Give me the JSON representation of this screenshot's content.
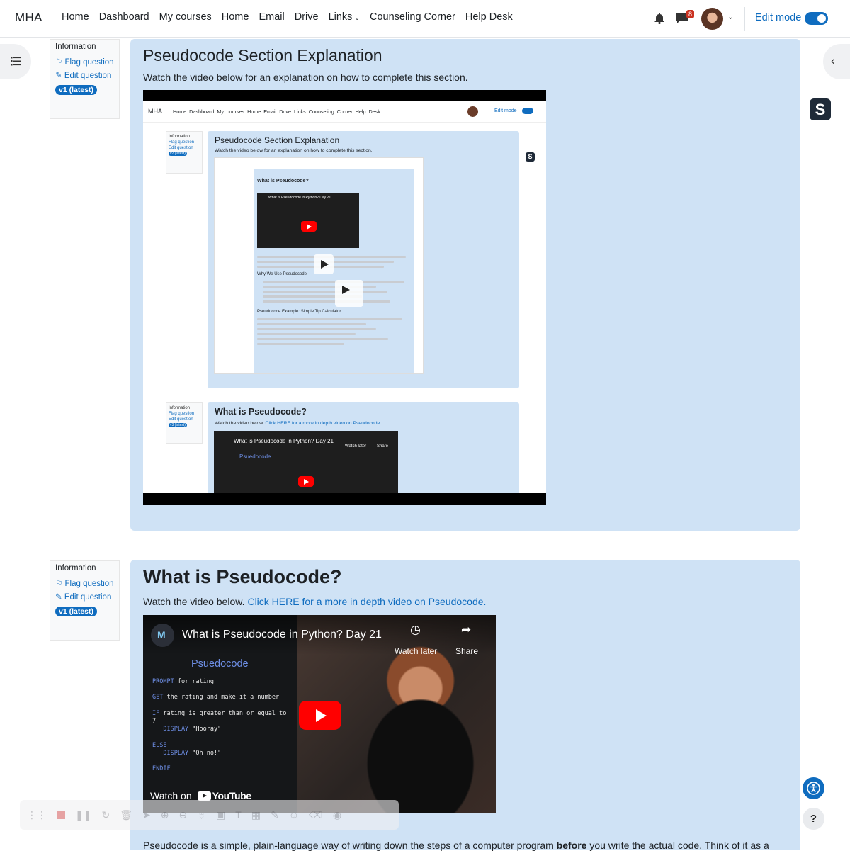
{
  "navbar": {
    "brand": "MHA",
    "links": [
      {
        "label": "Home"
      },
      {
        "label": "Dashboard"
      },
      {
        "label": "My courses"
      },
      {
        "label": "Home"
      },
      {
        "label": "Email"
      },
      {
        "label": "Drive"
      },
      {
        "label": "Links",
        "has_dropdown": true
      },
      {
        "label": "Counseling Corner"
      },
      {
        "label": "Help Desk"
      }
    ],
    "message_badge": "8",
    "edit_mode_label": "Edit mode",
    "edit_mode_on": true,
    "accent_color": "#0f6cbf"
  },
  "question1": {
    "info": {
      "title": "Information",
      "flag": "Flag question",
      "edit": "Edit question",
      "version": "v1 (latest)"
    },
    "title": "Pseudocode Section Explanation",
    "subtitle": "Watch the video below for an explanation on how to complete this section.",
    "recording": {
      "brand": "MHA",
      "nav": "Home Dashboard My courses Home Email Drive Links Counseling Corner Help Desk",
      "edit_mode": "Edit mode",
      "card1_title": "Pseudocode Section Explanation",
      "card1_sub": "Watch the video below for an explanation on how to complete this section.",
      "info_title": "Information",
      "info_flag": "Flag question",
      "info_edit": "Edit question",
      "card1_version": "v2 (latest)",
      "nested_title": "What is Pseudocode?",
      "nested_video_title": "What is Pseudocode in Python? Day 21",
      "nested_heading1": "Why We Use Pseudocode",
      "nested_heading2": "Pseudocode Example: Simple Tip Calculator",
      "card2_title": "What is Pseudocode?",
      "card2_sub": "Watch the video below.",
      "card2_link": "Click HERE for a more in depth video on Pseudocode.",
      "card2_version": "v3 (latest)",
      "video_title": "What is Pseudocode in Python? Day 21",
      "watch_later": "Watch later",
      "share": "Share",
      "psuedo": "Psuedocode"
    }
  },
  "question2": {
    "info": {
      "title": "Information",
      "flag": "Flag question",
      "edit": "Edit question",
      "version": "v1 (latest)"
    },
    "title": "What is Pseudocode?",
    "subtitle": "Watch the video below.",
    "link": "Click HERE for a more in depth video on Pseudocode.",
    "video": {
      "title": "What is Pseudocode in Python? Day 21",
      "watch_later": "Watch later",
      "share": "Share",
      "code_title": "Psuedocode",
      "code": [
        {
          "kw": "PROMPT",
          "rest": " for rating"
        },
        {
          "kw": "GET",
          "rest": " the rating and make it a number"
        },
        {
          "kw": "IF",
          "rest": " rating is greater than or equal to\n7"
        },
        {
          "kw": "   DISPLAY",
          "rest": " \"Hooray\""
        },
        {
          "kw": "ELSE",
          "rest": ""
        },
        {
          "kw": "   DISPLAY",
          "rest": " \"Oh no!\""
        },
        {
          "kw": "ENDIF",
          "rest": ""
        }
      ],
      "watch_on": "Watch on",
      "youtube": "YouTube"
    }
  },
  "body_text": {
    "before": "Pseudocode is a simple, plain-language way of writing down the steps of a computer program ",
    "bold": "before",
    "after": " you write the actual code. Think of it as a"
  },
  "widgets": {
    "help": "?"
  }
}
